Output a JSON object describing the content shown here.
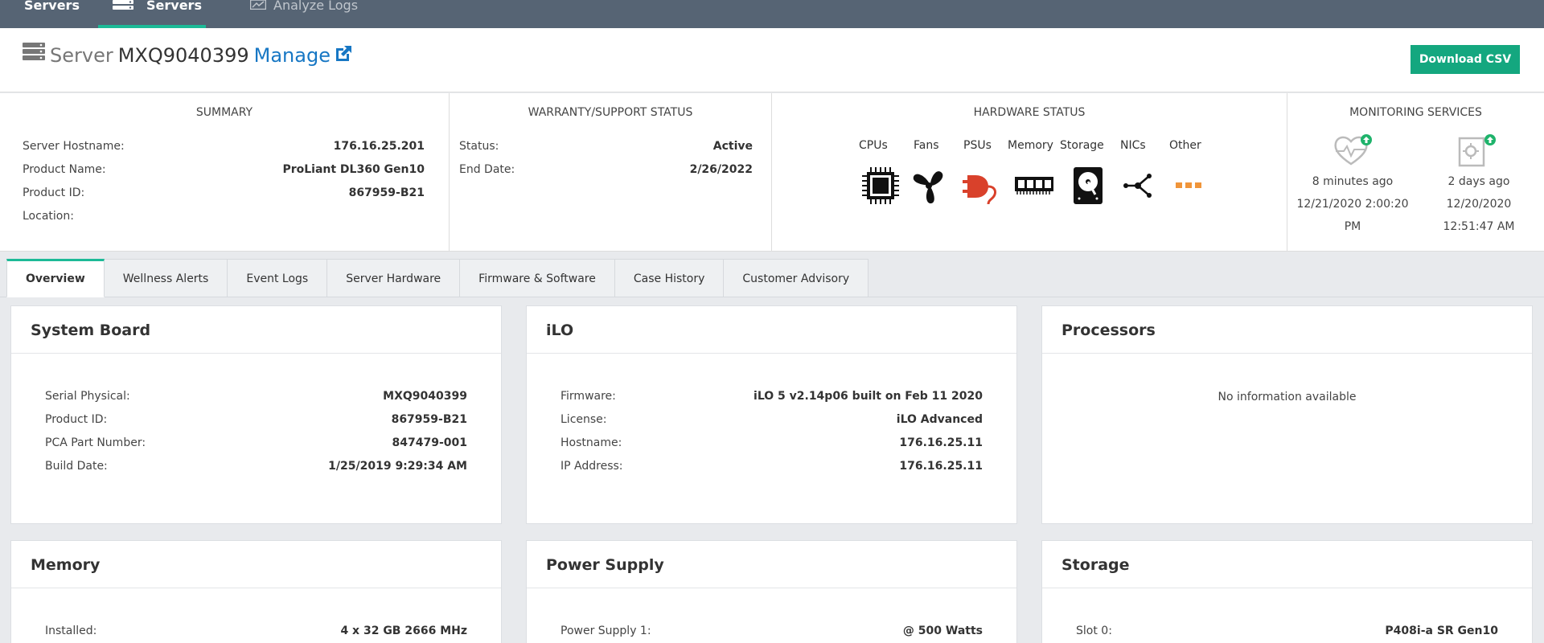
{
  "nav": {
    "tab1": "Servers",
    "tab2": "Servers",
    "tab3": "Analyze Logs"
  },
  "header": {
    "label": "Server",
    "server_id": "MXQ9040399",
    "manage": "Manage",
    "download": "Download CSV"
  },
  "summary": {
    "title": "SUMMARY",
    "rows": [
      {
        "k": "Server Hostname:",
        "v": "176.16.25.201"
      },
      {
        "k": "Product Name:",
        "v": "ProLiant DL360 Gen10"
      },
      {
        "k": "Product ID:",
        "v": "867959-B21"
      },
      {
        "k": "Location:",
        "v": ""
      }
    ]
  },
  "warranty": {
    "title": "WARRANTY/SUPPORT STATUS",
    "rows": [
      {
        "k": "Status:",
        "v": "Active"
      },
      {
        "k": "End Date:",
        "v": "2/26/2022"
      }
    ]
  },
  "hardware": {
    "title": "HARDWARE STATUS",
    "labels": [
      "CPUs",
      "Fans",
      "PSUs",
      "Memory",
      "Storage",
      "NICs",
      "Other"
    ],
    "colors": {
      "ok": "#111111",
      "warning": "#d9412b",
      "other": "#f0953a"
    }
  },
  "monitoring": {
    "title": "MONITORING SERVICES",
    "services": [
      {
        "ago": "8 minutes ago",
        "date1": "12/21/2020 2:00:20",
        "date2": "PM"
      },
      {
        "ago": "2 days ago",
        "date1": "12/20/2020",
        "date2": "12:51:47 AM"
      }
    ],
    "status_color": "#1fb36b"
  },
  "tabs": [
    "Overview",
    "Wellness Alerts",
    "Event Logs",
    "Server Hardware",
    "Firmware & Software",
    "Case History",
    "Customer Advisory"
  ],
  "cards": {
    "system_board": {
      "title": "System Board",
      "rows": [
        {
          "k": "Serial Physical:",
          "v": "MXQ9040399"
        },
        {
          "k": "Product ID:",
          "v": "867959-B21"
        },
        {
          "k": "PCA Part Number:",
          "v": "847479-001"
        },
        {
          "k": "Build Date:",
          "v": "1/25/2019 9:29:34 AM"
        }
      ]
    },
    "ilo": {
      "title": "iLO",
      "rows": [
        {
          "k": "Firmware:",
          "v": "iLO 5 v2.14p06 built on Feb 11 2020"
        },
        {
          "k": "License:",
          "v": "iLO Advanced"
        },
        {
          "k": "Hostname:",
          "v": "176.16.25.11"
        },
        {
          "k": "IP Address:",
          "v": "176.16.25.11"
        }
      ]
    },
    "processors": {
      "title": "Processors",
      "empty": "No information available"
    },
    "memory": {
      "title": "Memory",
      "rows": [
        {
          "k": "Installed:",
          "v": "4 x 32 GB 2666 MHz"
        }
      ]
    },
    "power": {
      "title": "Power Supply",
      "rows": [
        {
          "k": "Power Supply 1:",
          "v": "@ 500 Watts"
        }
      ]
    },
    "storage": {
      "title": "Storage",
      "rows": [
        {
          "k": "Slot 0:",
          "v": "P408i-a SR Gen10"
        }
      ]
    }
  },
  "accent": "#1dba97",
  "link_color": "#1777c4",
  "button_color": "#14a77f"
}
